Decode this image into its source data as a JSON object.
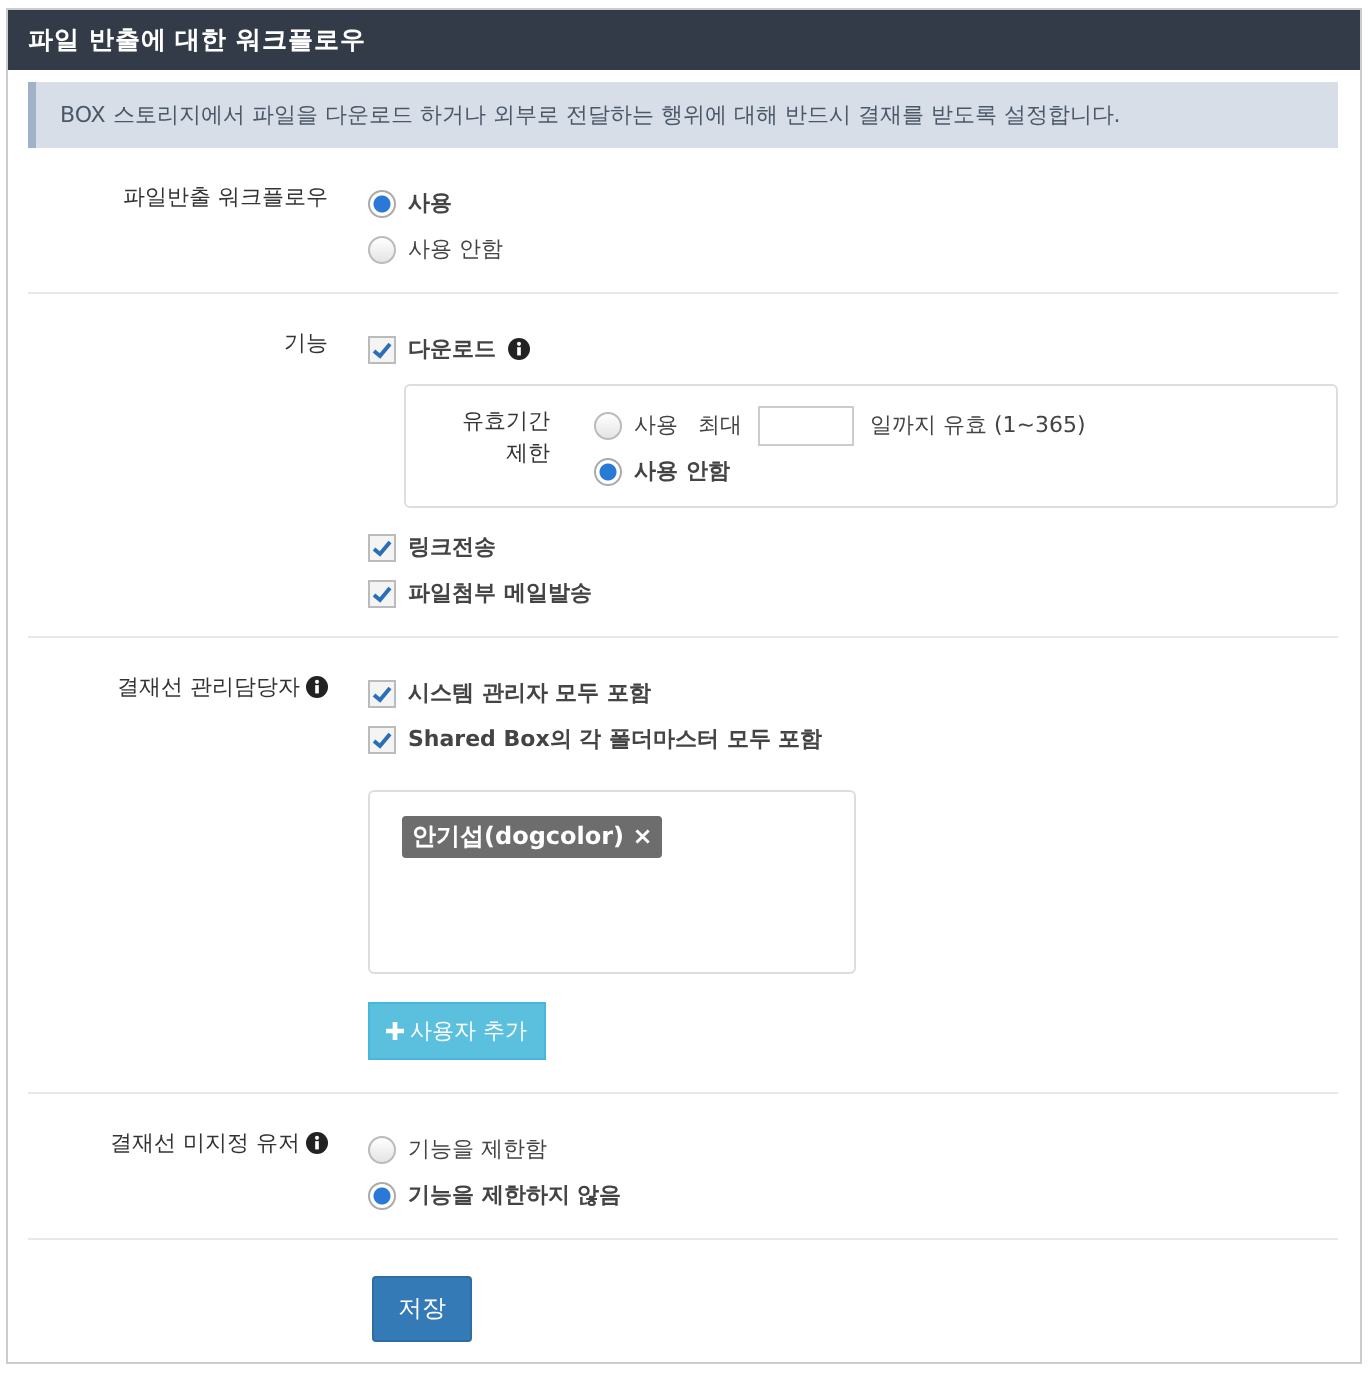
{
  "panel": {
    "title": "파일 반출에 대한 워크플로우"
  },
  "notice": "BOX 스토리지에서 파일을 다운로드 하거나 외부로 전달하는 행위에 대해 반드시 결재를 받도록 설정합니다.",
  "sections": [
    {
      "label": "파일반출 워크플로우",
      "items": [
        {
          "kind": "radio",
          "label": "사용",
          "selected": true
        },
        {
          "kind": "radio",
          "label": "사용 안함",
          "selected": false
        }
      ]
    },
    {
      "label": "기능",
      "items": [
        {
          "kind": "checkbox",
          "label": "다운로드",
          "checked": true,
          "info": true
        },
        {
          "kind": "expiry",
          "label": "유효기간 제한",
          "options": [
            {
              "label": "사용",
              "selected": false,
              "prefix": "최대",
              "suffix": "일까지 유효 (1~365)"
            },
            {
              "label": "사용 안함",
              "selected": true
            }
          ]
        },
        {
          "kind": "checkbox",
          "label": "링크전송",
          "checked": true
        },
        {
          "kind": "checkbox",
          "label": "파일첨부 메일발송",
          "checked": true
        }
      ]
    },
    {
      "label": "결재선 관리담당자",
      "info": true,
      "items": [
        {
          "kind": "checkbox",
          "label": "시스템 관리자 모두 포함",
          "checked": true
        },
        {
          "kind": "checkbox",
          "label": "Shared Box의 각 폴더마스터 모두 포함",
          "checked": true
        },
        {
          "kind": "tags",
          "tags": [
            {
              "label": "안기섭(dogcolor) ×"
            }
          ]
        },
        {
          "kind": "add_button",
          "label": "사용자 추가"
        }
      ]
    },
    {
      "label": "결재선 미지정 유저",
      "info": true,
      "items": [
        {
          "kind": "radio",
          "label": "기능을 제한함",
          "selected": false
        },
        {
          "kind": "radio",
          "label": "기능을 제한하지 않음",
          "selected": true
        }
      ]
    }
  ],
  "save_button": "저장"
}
